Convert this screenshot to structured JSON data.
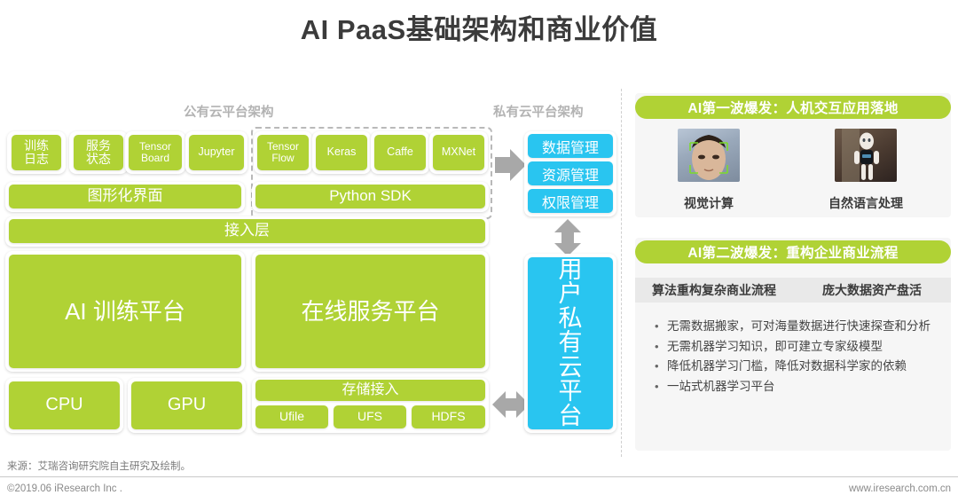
{
  "title": "AI PaaS基础架构和商业价值",
  "colors": {
    "green": "#b0d235",
    "blue": "#29c5f0",
    "gray_arrow": "#9e9e9e",
    "panel_bg": "#f6f6f6",
    "subhead_bg": "#e9e9e9"
  },
  "diagram": {
    "public_cloud_caption": "公有云平台架构",
    "private_cloud_caption": "私有云平台架构",
    "tools_row": [
      {
        "label": "训练\n日志",
        "lines": [
          "训练",
          "日志"
        ]
      },
      {
        "label": "服务\n状态",
        "lines": [
          "服务",
          "状态"
        ]
      },
      {
        "label": "Tensor Board",
        "lines": [
          "Tensor",
          "Board"
        ]
      },
      {
        "label": "Jupyter",
        "lines": [
          "Jupyter"
        ]
      },
      {
        "label": "Tensor Flow",
        "lines": [
          "Tensor",
          "Flow"
        ]
      },
      {
        "label": "Keras",
        "lines": [
          "Keras"
        ]
      },
      {
        "label": "Caffe",
        "lines": [
          "Caffe"
        ]
      },
      {
        "label": "MXNet",
        "lines": [
          "MXNet"
        ]
      }
    ],
    "interface_row": [
      {
        "label": "图形化界面"
      },
      {
        "label": "Python SDK"
      }
    ],
    "access_layer": "接入层",
    "platforms": [
      {
        "label": "AI 训练平台"
      },
      {
        "label": "在线服务平台"
      }
    ],
    "compute": [
      {
        "label": "CPU"
      },
      {
        "label": "GPU"
      }
    ],
    "storage_title": "存储接入",
    "storage_items": [
      {
        "label": "Ufile"
      },
      {
        "label": "UFS"
      },
      {
        "label": "HDFS"
      }
    ],
    "private_cloud_modules": [
      {
        "label": "数据管理"
      },
      {
        "label": "资源管理"
      },
      {
        "label": "权限管理"
      }
    ],
    "private_cloud_platform": {
      "lines": [
        "用",
        "户",
        "私",
        "有",
        "云",
        "平",
        "台"
      ],
      "label": "用户私有云平台"
    }
  },
  "right": {
    "wave1": {
      "header": "AI第一波爆发：人机交互应用落地",
      "items": [
        {
          "caption": "视觉计算",
          "image": "face-detection-photo"
        },
        {
          "caption": "自然语言处理",
          "image": "humanoid-robot-photo"
        }
      ]
    },
    "wave2": {
      "header": "AI第二波爆发：重构企业商业流程",
      "subheads": [
        "算法重构复杂商业流程",
        "庞大数据资产盘活"
      ],
      "bullets": [
        "无需数据搬家，可对海量数据进行快速探查和分析",
        "无需机器学习知识，即可建立专家级模型",
        "降低机器学习门槛，降低对数据科学家的依赖",
        "一站式机器学习平台"
      ]
    }
  },
  "footer": {
    "source": "来源：艾瑞咨询研究院自主研究及绘制。",
    "copyright": "©2019.06 iResearch Inc .",
    "url": "www.iresearch.com.cn"
  }
}
